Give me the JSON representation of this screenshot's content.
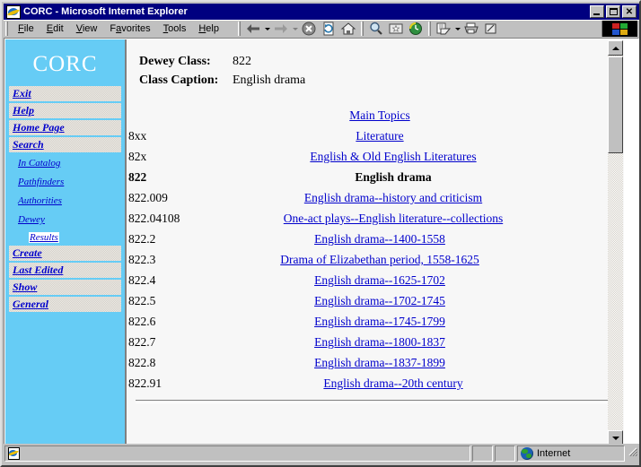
{
  "window": {
    "title": "CORC - Microsoft Internet Explorer",
    "title_icon": "ie-document-icon",
    "minimize_label": "Minimize",
    "maximize_label": "Maximize",
    "close_label": "Close"
  },
  "menubar": {
    "items": [
      {
        "label": "File",
        "accel": "F"
      },
      {
        "label": "Edit",
        "accel": "E"
      },
      {
        "label": "View",
        "accel": "V"
      },
      {
        "label": "Favorites",
        "accel": "a"
      },
      {
        "label": "Tools",
        "accel": "T"
      },
      {
        "label": "Help",
        "accel": "H"
      }
    ]
  },
  "toolbar": {
    "buttons": [
      {
        "name": "back-button",
        "icon": "left-arrow-icon",
        "label": "Back"
      },
      {
        "name": "back-dropdown",
        "icon": "caret-down-icon",
        "label": "Back history"
      },
      {
        "name": "forward-button",
        "icon": "right-arrow-icon",
        "label": "Forward"
      },
      {
        "name": "forward-dropdown",
        "icon": "caret-down-icon",
        "label": "Forward history"
      },
      {
        "name": "stop-button",
        "icon": "stop-icon",
        "label": "Stop"
      },
      {
        "name": "refresh-button",
        "icon": "refresh-icon",
        "label": "Refresh"
      },
      {
        "name": "home-button",
        "icon": "home-icon",
        "label": "Home"
      },
      {
        "name": "search-button",
        "icon": "search-icon",
        "label": "Search"
      },
      {
        "name": "favorites-button",
        "icon": "favorites-star-icon",
        "label": "Favorites"
      },
      {
        "name": "history-button",
        "icon": "history-clock-icon",
        "label": "History"
      },
      {
        "name": "mail-button",
        "icon": "mail-icon",
        "label": "Mail"
      },
      {
        "name": "mail-dropdown",
        "icon": "caret-down-icon",
        "label": "Mail menu"
      },
      {
        "name": "print-button",
        "icon": "printer-icon",
        "label": "Print"
      },
      {
        "name": "edit-button",
        "icon": "edit-page-icon",
        "label": "Edit"
      }
    ],
    "brand_icon": "ie-logo-animated-icon"
  },
  "sidebar": {
    "logo": "CORC",
    "main_items": [
      {
        "label": "Exit",
        "name": "sidebar-item-exit"
      },
      {
        "label": "Help",
        "name": "sidebar-item-help"
      },
      {
        "label": "Home Page",
        "name": "sidebar-item-home-page"
      },
      {
        "label": "Search",
        "name": "sidebar-item-search"
      }
    ],
    "sub_items": [
      {
        "label": "In Catalog",
        "name": "sidebar-subitem-in-catalog",
        "selected": false
      },
      {
        "label": "Pathfinders",
        "name": "sidebar-subitem-pathfinders",
        "selected": false
      },
      {
        "label": "Authorities",
        "name": "sidebar-subitem-authorities",
        "selected": false
      },
      {
        "label": "Dewey",
        "name": "sidebar-subitem-dewey",
        "selected": false
      },
      {
        "label": "Results",
        "name": "sidebar-subitem-results",
        "selected": true
      }
    ],
    "main_items_bottom": [
      {
        "label": "Create",
        "name": "sidebar-item-create"
      },
      {
        "label": "Last Edited",
        "name": "sidebar-item-last-edited"
      },
      {
        "label": "Show",
        "name": "sidebar-item-show"
      },
      {
        "label": "General",
        "name": "sidebar-item-general"
      }
    ]
  },
  "content": {
    "dewey_class_label": "Dewey Class:",
    "dewey_class_value": "822",
    "class_caption_label": "Class Caption:",
    "class_caption_value": "English drama",
    "main_topics_header": "Main Topics",
    "rows": [
      {
        "number": "8xx",
        "caption": "Literature",
        "link": true,
        "current": false,
        "indent": 0
      },
      {
        "number": "82x",
        "caption": "English & Old English Literatures",
        "link": true,
        "current": false,
        "indent": 1
      },
      {
        "number": "822",
        "caption": "English drama",
        "link": false,
        "current": true,
        "indent": 1
      },
      {
        "number": "822.009",
        "caption": "English drama--history and criticism",
        "link": true,
        "current": false,
        "indent": 1
      },
      {
        "number": "822.04108",
        "caption": "One-act plays--English literature--collections",
        "link": true,
        "current": false,
        "indent": 1
      },
      {
        "number": "822.2",
        "caption": "English drama--1400-1558",
        "link": true,
        "current": false,
        "indent": 0
      },
      {
        "number": "822.3",
        "caption": "Drama of Elizabethan period, 1558-1625",
        "link": true,
        "current": false,
        "indent": 0
      },
      {
        "number": "822.4",
        "caption": "English drama--1625-1702",
        "link": true,
        "current": false,
        "indent": 0
      },
      {
        "number": "822.5",
        "caption": "English drama--1702-1745",
        "link": true,
        "current": false,
        "indent": 0
      },
      {
        "number": "822.6",
        "caption": "English drama--1745-1799",
        "link": true,
        "current": false,
        "indent": 0
      },
      {
        "number": "822.7",
        "caption": "English drama--1800-1837",
        "link": true,
        "current": false,
        "indent": 0
      },
      {
        "number": "822.8",
        "caption": "English drama--1837-1899",
        "link": true,
        "current": false,
        "indent": 0
      },
      {
        "number": "822.91",
        "caption": "English drama--20th century",
        "link": true,
        "current": false,
        "indent": 1
      }
    ]
  },
  "scrollbar": {
    "up_icon": "arrow-up-icon",
    "down_icon": "arrow-down-icon",
    "thumb_name": "vertical-scroll-thumb"
  },
  "statusbar": {
    "message": "",
    "zone_label": "Internet",
    "zone_icon": "globe-icon",
    "document_icon": "ie-document-icon"
  },
  "colors": {
    "titlebar": "#000080",
    "sidebar_bg": "#66ccf5",
    "link": "#0000cc",
    "chrome": "#c0c0c0",
    "page_bg": "#f7f7f7"
  }
}
